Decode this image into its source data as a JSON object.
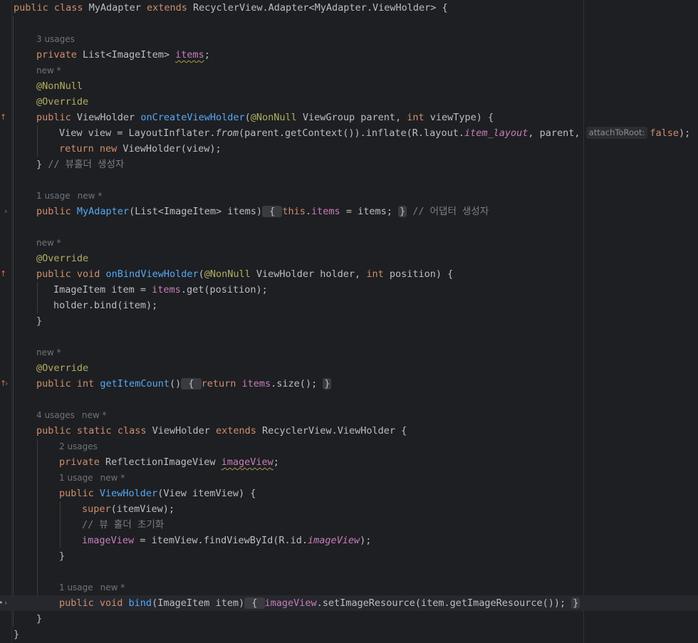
{
  "editor": {
    "lines": {
      "l1": {
        "c1": "public class ",
        "c2": "MyAdapter ",
        "c3": "extends ",
        "c4": "RecyclerView.Adapter<MyAdapter.ViewHolder> {"
      },
      "h_items": [
        "3 usages"
      ],
      "l_items": {
        "c1": "private ",
        "c2": "List<ImageItem> ",
        "c3": "items",
        "c4": ";"
      },
      "h_create": [
        "new *"
      ],
      "l_nonnull": "@NonNull",
      "l_override1": "@Override",
      "l_create": {
        "c1": "public ",
        "c2": "ViewHolder ",
        "c3": "onCreateViewHolder",
        "c4": "(",
        "c5": "@NonNull ",
        "c6": "ViewGroup parent, ",
        "c7": "int ",
        "c8": "viewType) {"
      },
      "l_view": {
        "c1": "View view = LayoutInflater.",
        "c2": "from",
        "c3": "(parent.getContext()).inflate(R.layout.",
        "c4": "item_layout",
        "c5": ", parent, ",
        "hint": "attachToRoot:",
        "c6": "false",
        "c7": ");"
      },
      "l_return1": {
        "c1": "return ",
        "c2": "new ",
        "c3": "ViewHolder(view);"
      },
      "l_close1": {
        "c1": "} ",
        "c2": "// 뷰홀더 생성자"
      },
      "h_ctor": [
        "1 usage",
        "new *"
      ],
      "l_ctor": {
        "c1": "public ",
        "c2": "MyAdapter",
        "c3": "(List<ImageItem> items)",
        "c4": " { ",
        "c5": "this",
        "c6": ".",
        "c7": "items",
        "c8": " = items; ",
        "c9": "}",
        "c10": " // 어댑터 생성자"
      },
      "h_bind": [
        "new *"
      ],
      "l_override2": "@Override",
      "l_bindvh": {
        "c1": "public ",
        "c2": "void ",
        "c3": "onBindViewHolder",
        "c4": "(",
        "c5": "@NonNull ",
        "c6": "ViewHolder holder, ",
        "c7": "int ",
        "c8": "position) {"
      },
      "l_item": {
        "c1": "ImageItem item = ",
        "c2": "items",
        "c3": ".get(position);"
      },
      "l_holderbind": "holder.bind(item);",
      "l_close2": "}",
      "h_count": [
        "new *"
      ],
      "l_override3": "@Override",
      "l_count": {
        "c1": "public ",
        "c2": "int ",
        "c3": "getItemCount",
        "c4": "()",
        "c5": " { ",
        "c6": "return ",
        "c7": "items",
        "c8": ".size(); ",
        "c9": "}"
      },
      "h_vh": [
        "4 usages",
        "new *"
      ],
      "l_vh": {
        "c1": "public ",
        "c2": "static ",
        "c3": "class ",
        "c4": "ViewHolder ",
        "c5": "extends ",
        "c6": "RecyclerView.ViewHolder {"
      },
      "h_iv": [
        "2 usages"
      ],
      "l_iv": {
        "c1": "private ",
        "c2": "ReflectionImageView ",
        "c3": "imageView",
        "c4": ";"
      },
      "h_vhctor": [
        "1 usage",
        "new *"
      ],
      "l_vhctor": {
        "c1": "public ",
        "c2": "ViewHolder",
        "c3": "(View itemView) {"
      },
      "l_super": {
        "c1": "super",
        "c2": "(itemView);"
      },
      "l_comment": "// 뷰 홀더 초기화",
      "l_find": {
        "c1": "imageView",
        "c2": " = itemView.findViewById(R.id.",
        "c3": "imageView",
        "c4": ");"
      },
      "l_close3": "}",
      "h_bindm": [
        "1 usage",
        "new *"
      ],
      "l_bindm": {
        "c1": "public ",
        "c2": "void ",
        "c3": "bind",
        "c4": "(ImageItem item)",
        "c5": " { ",
        "c6": "imageView",
        "c7": ".setImageResource(item.getImageResource()); ",
        "c8": "}"
      },
      "l_close4": "}",
      "l_close5": "}"
    }
  }
}
